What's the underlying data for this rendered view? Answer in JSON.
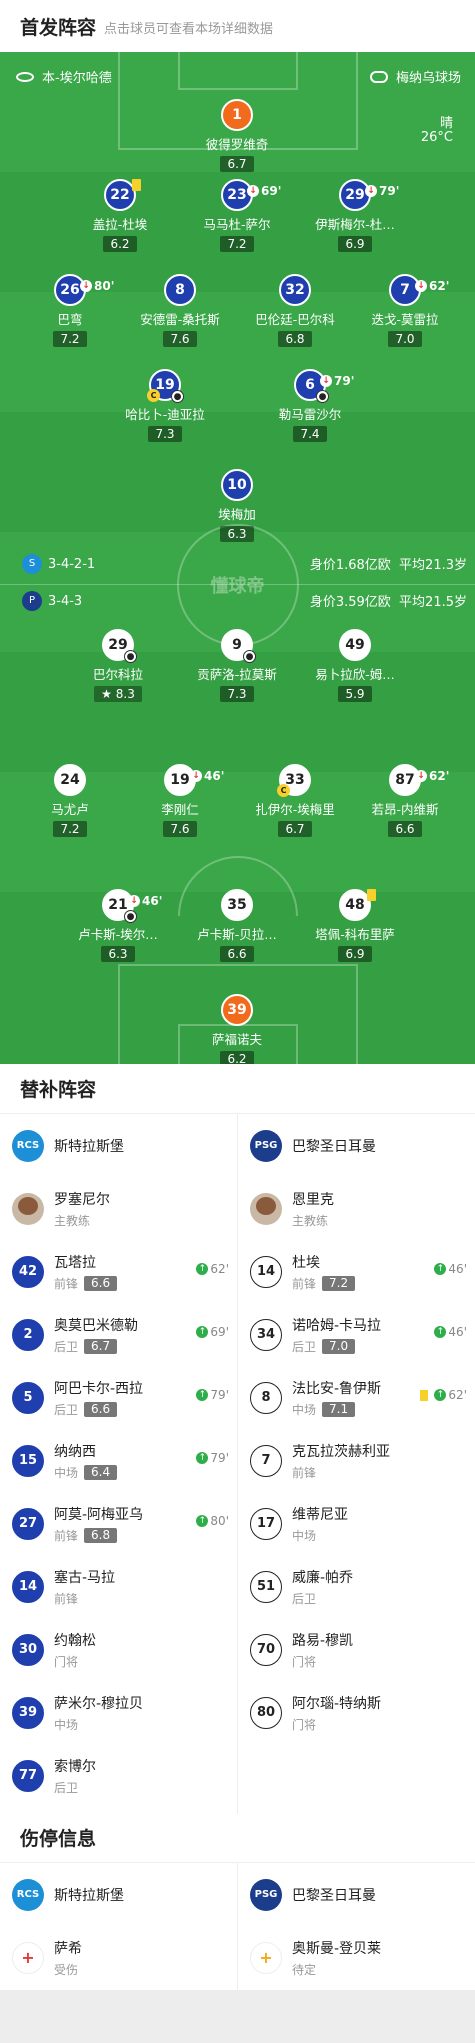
{
  "header": {
    "title": "首发阵容",
    "subtitle": "点击球员可查看本场详细数据"
  },
  "pitch_info": {
    "team_left": "本-埃尔哈德",
    "stadium": "梅纳乌球场",
    "weather": "晴",
    "temperature": "26°C",
    "watermark": "懂球帝"
  },
  "home_team": {
    "formation": "3-4-2-1",
    "value": "身价1.68亿欧",
    "avg_age": "平均21.3岁"
  },
  "away_team": {
    "formation": "3-4-3",
    "value": "身价3.59亿欧",
    "avg_age": "平均21.5岁"
  },
  "home_players": [
    {
      "num": "1",
      "name": "彼得罗维奇",
      "rating": "6.7",
      "gk": true
    },
    {
      "num": "22",
      "name": "盖拉-杜埃",
      "rating": "6.2",
      "yellow": true
    },
    {
      "num": "23",
      "name": "马马杜-萨尔",
      "rating": "7.2",
      "sub": "69'"
    },
    {
      "num": "29",
      "name": "伊斯梅尔-杜…",
      "rating": "6.9",
      "sub": "79'"
    },
    {
      "num": "26",
      "name": "巴弯",
      "rating": "7.2",
      "sub": "80'"
    },
    {
      "num": "8",
      "name": "安德雷-桑托斯",
      "rating": "7.6"
    },
    {
      "num": "32",
      "name": "巴伦廷-巴尔科",
      "rating": "6.8"
    },
    {
      "num": "7",
      "name": "迭戈-莫雷拉",
      "rating": "7.0",
      "sub": "62'"
    },
    {
      "num": "19",
      "name": "哈比卜-迪亚拉",
      "rating": "7.3",
      "captain": true,
      "goal": true
    },
    {
      "num": "6",
      "name": "勒马雷沙尔",
      "rating": "7.4",
      "sub": "79'",
      "goal": true
    },
    {
      "num": "10",
      "name": "埃梅加",
      "rating": "6.3"
    }
  ],
  "away_players": [
    {
      "num": "29",
      "name": "巴尔科拉",
      "rating": "8.3",
      "star": true,
      "goal": true
    },
    {
      "num": "9",
      "name": "贡萨洛-拉莫斯",
      "rating": "7.3",
      "goal": true
    },
    {
      "num": "49",
      "name": "易卜拉欣-姆…",
      "rating": "5.9"
    },
    {
      "num": "24",
      "name": "马尤卢",
      "rating": "7.2"
    },
    {
      "num": "19",
      "name": "李刚仁",
      "rating": "7.6",
      "sub": "46'"
    },
    {
      "num": "33",
      "name": "扎伊尔-埃梅里",
      "rating": "6.7",
      "captain": true
    },
    {
      "num": "87",
      "name": "若昂-内维斯",
      "rating": "6.6",
      "sub": "62'"
    },
    {
      "num": "21",
      "name": "卢卡斯-埃尔…",
      "rating": "6.3",
      "sub": "46'",
      "goal": true
    },
    {
      "num": "35",
      "name": "卢卡斯-贝拉…",
      "rating": "6.6"
    },
    {
      "num": "48",
      "name": "塔佩-科布里萨",
      "rating": "6.9",
      "yellow": true
    },
    {
      "num": "39",
      "name": "萨福诺夫",
      "rating": "6.2",
      "gk": true
    }
  ],
  "subs_section": {
    "title": "替补阵容"
  },
  "home_bench": {
    "team": "斯特拉斯堡",
    "coach": "罗塞尼尔",
    "coach_role": "主教练",
    "players": [
      {
        "num": "42",
        "name": "瓦塔拉",
        "pos": "前锋",
        "rating": "6.6",
        "sub": "62'"
      },
      {
        "num": "2",
        "name": "奥莫巴米德勒",
        "pos": "后卫",
        "rating": "6.7",
        "sub": "69'"
      },
      {
        "num": "5",
        "name": "阿巴卡尔-西拉",
        "pos": "后卫",
        "rating": "6.6",
        "sub": "79'"
      },
      {
        "num": "15",
        "name": "纳纳西",
        "pos": "中场",
        "rating": "6.4",
        "sub": "79'"
      },
      {
        "num": "27",
        "name": "阿莫-阿梅亚乌",
        "pos": "前锋",
        "rating": "6.8",
        "sub": "80'"
      },
      {
        "num": "14",
        "name": "塞古-马拉",
        "pos": "前锋"
      },
      {
        "num": "30",
        "name": "约翰松",
        "pos": "门将"
      },
      {
        "num": "39",
        "name": "萨米尔-穆拉贝",
        "pos": "中场"
      },
      {
        "num": "77",
        "name": "索博尔",
        "pos": "后卫"
      }
    ]
  },
  "away_bench": {
    "team": "巴黎圣日耳曼",
    "coach": "恩里克",
    "coach_role": "主教练",
    "players": [
      {
        "num": "14",
        "name": "杜埃",
        "pos": "前锋",
        "rating": "7.2",
        "sub": "46'"
      },
      {
        "num": "34",
        "name": "诺哈姆-卡马拉",
        "pos": "后卫",
        "rating": "7.0",
        "sub": "46'"
      },
      {
        "num": "8",
        "name": "法比安-鲁伊斯",
        "pos": "中场",
        "rating": "7.1",
        "sub": "62'",
        "yellow": true
      },
      {
        "num": "7",
        "name": "克瓦拉茨赫利亚",
        "pos": "前锋"
      },
      {
        "num": "17",
        "name": "维蒂尼亚",
        "pos": "中场"
      },
      {
        "num": "51",
        "name": "威廉-帕乔",
        "pos": "后卫"
      },
      {
        "num": "70",
        "name": "路易-穆凯",
        "pos": "门将"
      },
      {
        "num": "80",
        "name": "阿尔瑙-特纳斯",
        "pos": "门将"
      }
    ]
  },
  "injury_section": {
    "title": "伤停信息"
  },
  "injuries": {
    "home": {
      "team": "斯特拉斯堡",
      "player": "萨希",
      "status": "受伤"
    },
    "away": {
      "team": "巴黎圣日耳曼",
      "player": "奥斯曼-登贝莱",
      "status": "待定"
    }
  },
  "colors": {
    "pitch": "#35a043",
    "home": "#1f3fae",
    "away": "#ffffff",
    "gk_home": "#f26a1b",
    "gk_away": "#f26a1b",
    "sub_in": "#2eae4a",
    "yellow": "#f7d02a"
  }
}
